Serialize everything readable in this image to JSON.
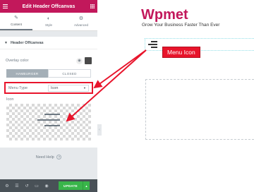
{
  "panel": {
    "title": "Edit Header Offcanvas",
    "tabs": [
      {
        "label": "Content",
        "icon": "pencil-icon"
      },
      {
        "label": "Style",
        "icon": "contrast-icon"
      },
      {
        "label": "Advanced",
        "icon": "gear-icon"
      }
    ],
    "section_title": "Header Offcanvas",
    "overlay_label": "Overlay color",
    "overlay_color": "#4a4a4a",
    "toggle": {
      "hamburger": "HAMBURGER",
      "closed": "CLOSED"
    },
    "menu_type_label": "Menu Type",
    "menu_type_value": "Icon",
    "icon_label": "Icon",
    "need_help": "Need Help",
    "update_label": "UPDATE"
  },
  "preview": {
    "brand": "Wpmet",
    "tagline": "Grow Your Business Faster Than Ever",
    "callout": "Menu Icon"
  },
  "colors": {
    "brand": "#c2185b",
    "callout": "#e8142b",
    "update": "#39b54a"
  }
}
